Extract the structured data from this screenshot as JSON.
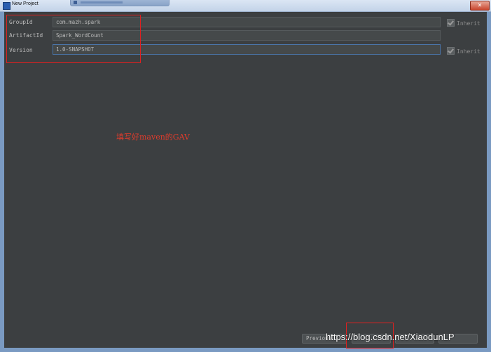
{
  "window": {
    "title": "New Project",
    "close_glyph": "✕"
  },
  "form": {
    "group_id": {
      "label": "GroupId",
      "value": "com.mazh.spark",
      "inherit_label": "Inherit"
    },
    "artifact_id": {
      "label": "ArtifactId",
      "value": "Spark_WordCount"
    },
    "version": {
      "label": "Version",
      "value": "1.0-SNAPSHOT",
      "inherit_label": "Inherit"
    }
  },
  "annotation": {
    "text": "填写好maven的GAV",
    "color": "#e23c2c"
  },
  "footer": {
    "previous_label": "Previous"
  },
  "watermark": {
    "text": "https://blog.csdn.net/XiaodunLP"
  },
  "colors": {
    "panel_bg": "#3c3f41",
    "field_bg": "#45494a",
    "text": "#bbbbbb",
    "highlight": "#e02020",
    "focus_border": "#4a74a8"
  }
}
